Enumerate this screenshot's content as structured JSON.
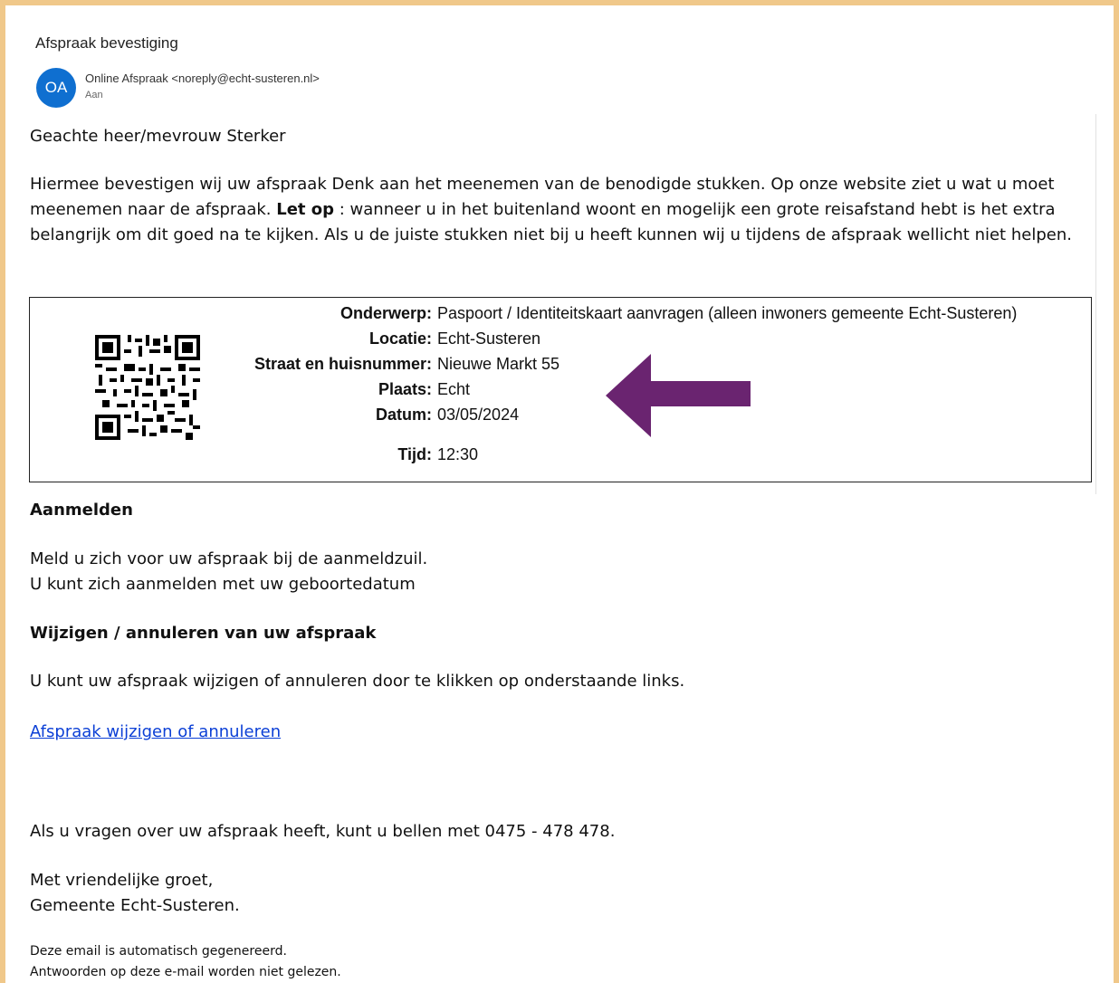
{
  "email": {
    "subject": "Afspraak bevestiging",
    "avatar_initials": "OA",
    "sender": "Online Afspraak <noreply@echt-susteren.nl>",
    "to_label": "Aan"
  },
  "greeting": "Geachte heer/mevrouw Sterker",
  "intro": {
    "part1": "Hiermee bevestigen wij uw afspraak Denk aan het meenemen van de benodigde stukken. Op onze website ziet u wat u moet meenemen naar de afspraak. ",
    "bold": "Let op",
    "part2": " : wanneer u in het buitenland woont en mogelijk een grote reisafstand hebt is het extra belangrijk om dit goed na te kijken. Als u de juiste stukken niet bij u heeft kunnen wij u tijdens de afspraak wellicht niet helpen."
  },
  "appointment": {
    "subject_label": "Onderwerp:",
    "subject_value": "Paspoort / Identiteitskaart aanvragen (alleen inwoners gemeente Echt-Susteren)",
    "location_label": "Locatie:",
    "location_value": "Echt-Susteren",
    "street_label": "Straat en huisnummer:",
    "street_value": "Nieuwe Markt 55",
    "place_label": "Plaats:",
    "place_value": "Echt",
    "date_label": "Datum:",
    "date_value": "03/05/2024",
    "time_label": "Tijd:",
    "time_value": "12:30",
    "arrow_color": "#6a2470"
  },
  "checkin": {
    "heading": "Aanmelden",
    "line1": "Meld u zich voor uw afspraak bij de aanmeldzuil.",
    "line2": "U kunt zich aanmelden met uw geboortedatum"
  },
  "change": {
    "heading": "Wijzigen / annuleren van uw afspraak",
    "text": "U kunt uw afspraak wijzigen of annuleren door te klikken op onderstaande links.",
    "link": "Afspraak wijzigen of annuleren"
  },
  "contact": "Als u vragen over uw afspraak heeft, kunt u bellen met 0475 - 478 478.",
  "closing": {
    "line1": "Met vriendelijke groet,",
    "line2": "Gemeente Echt-Susteren."
  },
  "footer": {
    "line1": "Deze email is automatisch gegenereerd.",
    "line2": "Antwoorden op deze e-mail worden niet gelezen."
  }
}
